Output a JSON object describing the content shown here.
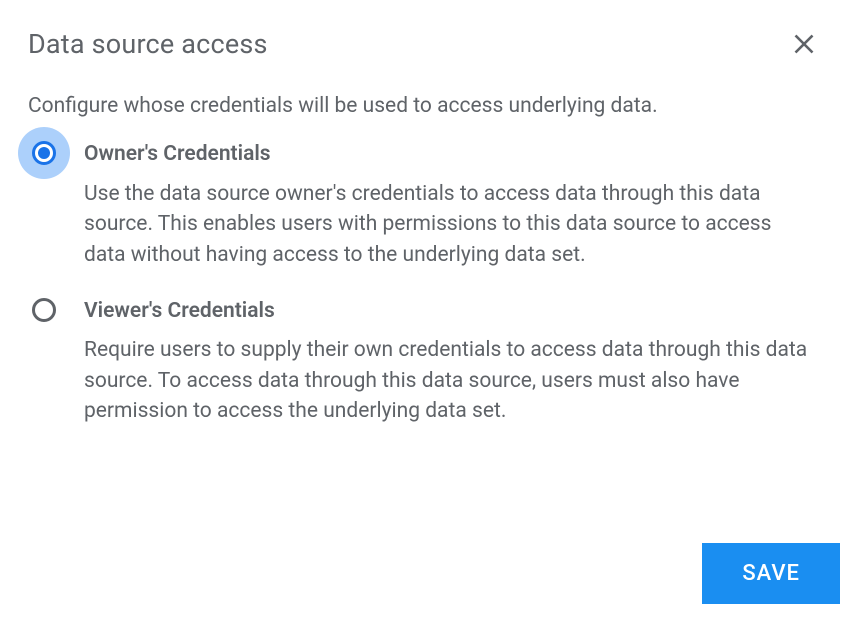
{
  "dialog": {
    "title": "Data source access",
    "description": "Configure whose credentials will be used to access underlying data."
  },
  "options": {
    "owner": {
      "label": "Owner's Credentials",
      "description": "Use the data source owner's credentials to access data through this data source. This enables users with permissions to this data source to access data without having access to the underlying data set.",
      "selected": true
    },
    "viewer": {
      "label": "Viewer's Credentials",
      "description": "Require users to supply their own credentials to access data through this data source. To access data through this data source, users must also have permission to access the underlying data set.",
      "selected": false
    }
  },
  "buttons": {
    "save": "SAVE"
  }
}
